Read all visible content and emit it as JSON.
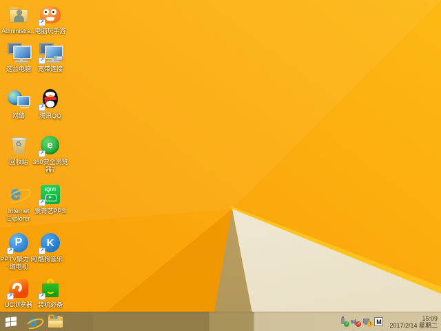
{
  "wallpaper": {
    "base_top_right": "#fdb913",
    "base_bottom_left": "#f79e08",
    "facet_deep_orange": "#f29a03",
    "facet_tan": "#c4a660",
    "facet_cream": "#f5efdb",
    "edge_highlight": "#ffc21f"
  },
  "desktop_icons": [
    {
      "label": "Administra...",
      "shortcut": false
    },
    {
      "label": "电脑玩手游",
      "shortcut": true
    },
    {
      "label": "这台电脑",
      "shortcut": false
    },
    {
      "label": "宽带连接",
      "shortcut": true
    },
    {
      "label": "网络",
      "shortcut": false
    },
    {
      "label": "腾讯QQ",
      "shortcut": true
    },
    {
      "label": "回收站",
      "shortcut": false
    },
    {
      "label": "360安全浏览器7",
      "shortcut": true
    },
    {
      "label": "Internet Explorer",
      "shortcut": false
    },
    {
      "label": "爱奇艺PPS",
      "shortcut": true
    },
    {
      "label": "PPTV聚力 网络电视",
      "shortcut": true
    },
    {
      "label": "酷狗音乐",
      "shortcut": true
    },
    {
      "label": "UC浏览器",
      "shortcut": true
    },
    {
      "label": "装机必备",
      "shortcut": true
    }
  ],
  "glyphs": {
    "shortcut_arrow": "↗",
    "recycle": "♻",
    "ie_letter": "e",
    "e360_letter": "e",
    "iqiyi_text": "iQIYI",
    "pptv_letter": "P",
    "kugou_letter": "K",
    "check": "✓",
    "cross": "✕",
    "warning": "!"
  },
  "taskbar": {
    "tray": {
      "ime_indicator": "M",
      "time": "15:09",
      "date": "2017/2/14 星期二"
    }
  }
}
